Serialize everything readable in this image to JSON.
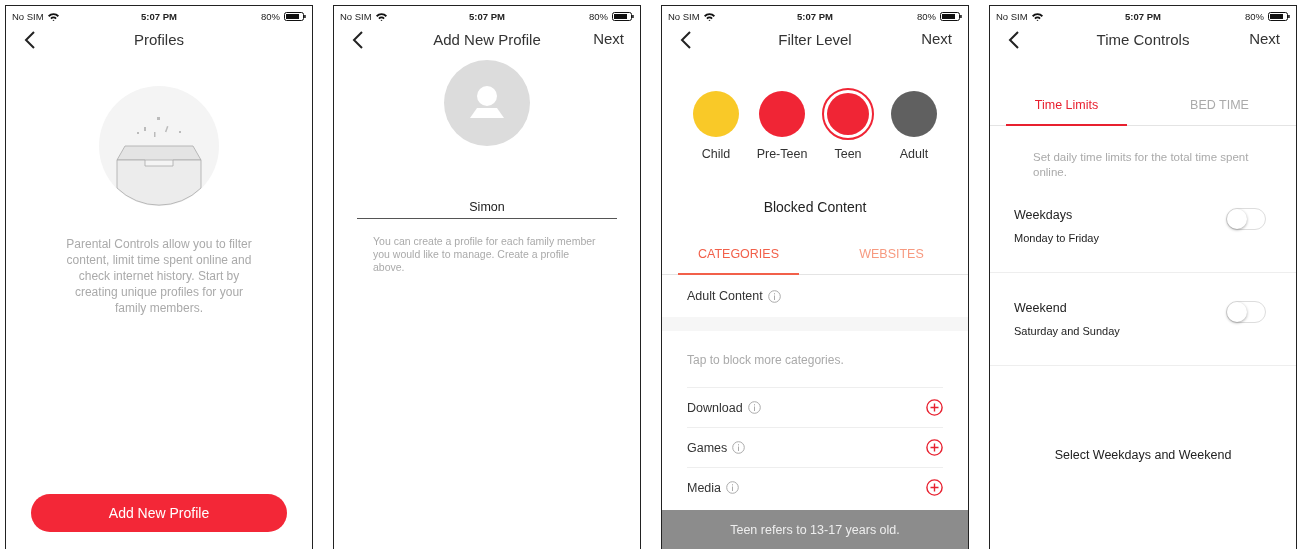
{
  "screens": [
    {
      "kind": "empty",
      "status": {
        "carrier": "No SIM",
        "time": "5:07 PM",
        "battery": "80%"
      },
      "title": "Profiles",
      "description": "Parental Controls allow you to filter content, limit time spent online and check internet history. Start by creating unique profiles for your family members.",
      "button": "Add New Profile"
    },
    {
      "kind": "new_profile",
      "status": {
        "carrier": "No SIM",
        "time": "5:07 PM",
        "battery": "80%"
      },
      "title": "Add New Profile",
      "next": "Next",
      "name_field": {
        "value": "Simon"
      },
      "hint": "You can create a profile for each family member you would like to manage. Create a profile above."
    },
    {
      "kind": "filter",
      "status": {
        "carrier": "No SIM",
        "time": "5:07 PM",
        "battery": "80%"
      },
      "title": "Filter Level",
      "next": "Next",
      "levels": [
        {
          "label": "Child",
          "color": "#f9c928",
          "selected": false
        },
        {
          "label": "Pre-Teen",
          "color": "#f02535",
          "selected": false
        },
        {
          "label": "Teen",
          "color": "#f02535",
          "selected": true
        },
        {
          "label": "Adult",
          "color": "#606060",
          "selected": false
        }
      ],
      "section_title": "Blocked Content",
      "tabs": [
        {
          "label": "CATEGORIES",
          "selected": true
        },
        {
          "label": "WEBSITES",
          "selected": false
        }
      ],
      "blocked": [
        {
          "label": "Adult Content"
        }
      ],
      "hint": "Tap to block more categories.",
      "categories": [
        {
          "label": "Download"
        },
        {
          "label": "Games"
        },
        {
          "label": "Media"
        }
      ],
      "toast": "Teen refers to 13-17 years old."
    },
    {
      "kind": "time",
      "status": {
        "carrier": "No SIM",
        "time": "5:07 PM",
        "battery": "80%"
      },
      "title": "Time Controls",
      "next": "Next",
      "tabs": [
        {
          "label": "Time Limits",
          "selected": true
        },
        {
          "label": "BED TIME",
          "selected": false
        }
      ],
      "description": "Set daily time limits for the total time spent online.",
      "schedules": [
        {
          "title": "Weekdays",
          "subtitle": "Monday to Friday",
          "on": false
        },
        {
          "title": "Weekend",
          "subtitle": "Saturday and Sunday",
          "on": false
        }
      ],
      "footer": "Select Weekdays and Weekend"
    }
  ]
}
